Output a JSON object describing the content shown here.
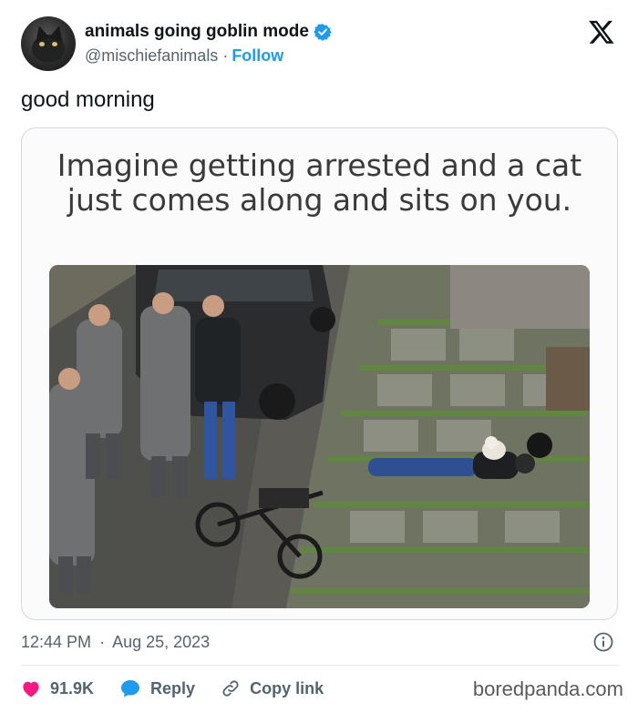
{
  "author": {
    "display_name": "animals going goblin mode",
    "handle": "@mischiefanimals",
    "separator": "·",
    "follow_label": "Follow",
    "verified_color": "#1d9bf0"
  },
  "platform_logo": "x-logo",
  "tweet": {
    "text": "good morning"
  },
  "media": {
    "caption_line1": "Imagine getting arrested and a cat",
    "caption_line2": "just comes along and sits on you."
  },
  "meta": {
    "time": "12:44 PM",
    "separator": "·",
    "date": "Aug 25, 2023"
  },
  "actions": {
    "like_count": "91.9K",
    "reply_label": "Reply",
    "copy_link_label": "Copy link"
  },
  "colors": {
    "like": "#f91880",
    "reply": "#1d9bf0",
    "link": "#1d9bf0",
    "secondary_text": "#536471"
  },
  "watermark": "boredpanda.com"
}
